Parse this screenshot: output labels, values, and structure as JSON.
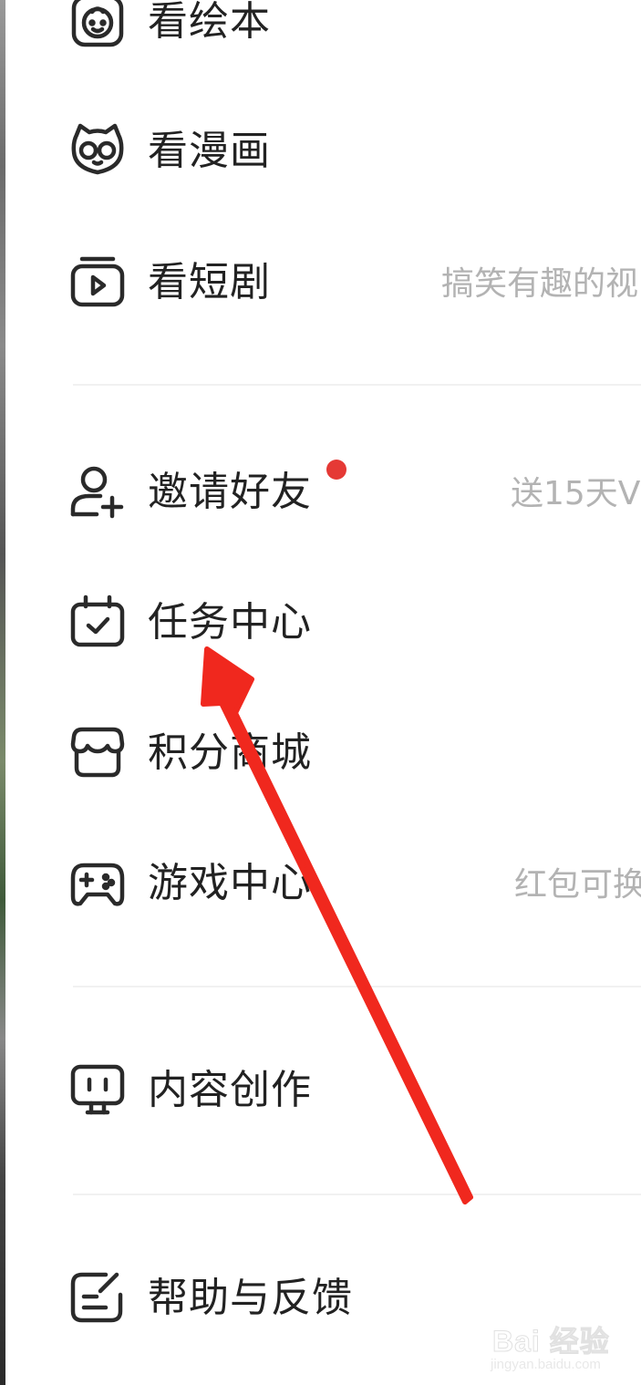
{
  "menu": {
    "items": [
      {
        "label": "看绘本",
        "icon": "picture-book-face-icon",
        "subtitle": ""
      },
      {
        "label": "看漫画",
        "icon": "comic-cat-glasses-icon",
        "subtitle": ""
      },
      {
        "label": "看短剧",
        "icon": "short-drama-play-icon",
        "subtitle": "搞笑有趣的视"
      },
      {
        "label": "邀请好友",
        "icon": "invite-friend-user-plus-icon",
        "subtitle": "送15天V",
        "has_badge": true
      },
      {
        "label": "任务中心",
        "icon": "task-calendar-check-icon",
        "subtitle": ""
      },
      {
        "label": "积分商城",
        "icon": "points-mall-store-icon",
        "subtitle": ""
      },
      {
        "label": "游戏中心",
        "icon": "gamepad-icon",
        "subtitle": "红包可换"
      },
      {
        "label": "内容创作",
        "icon": "content-creation-monitor-icon",
        "subtitle": ""
      },
      {
        "label": "帮助与反馈",
        "icon": "help-feedback-edit-icon",
        "subtitle": ""
      }
    ]
  },
  "colors": {
    "text": "#222222",
    "subtext": "#b3b3b3",
    "badge": "#e53935",
    "arrow": "#f0281e",
    "divider": "#f1f1f1"
  },
  "watermark": {
    "brand": "Bai 经验",
    "url": "jingyan.baidu.com"
  }
}
